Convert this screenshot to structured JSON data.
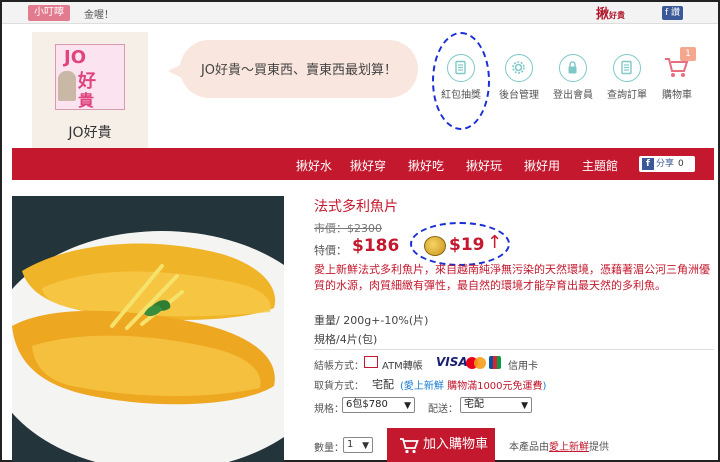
{
  "topbar": {
    "reminder_tag": "小叮嚀",
    "reminder_text": "金喔！",
    "share_logo": "揪",
    "share_logo_sub": "好貴",
    "fb_button": "f 讚"
  },
  "header": {
    "logo_chars": {
      "jo": "JO",
      "hao": "好",
      "gui": "貴"
    },
    "logo_name": "JO好貴",
    "slogan": "JO好貴～買東西、賣東西最划算！",
    "icons": [
      {
        "label": "紅包抽獎",
        "icon": "document-icon"
      },
      {
        "label": "後台管理",
        "icon": "gear-icon"
      },
      {
        "label": "登出會員",
        "icon": "lock-icon"
      },
      {
        "label": "查詢訂單",
        "icon": "document-icon"
      },
      {
        "label": "購物車",
        "icon": "cart-icon"
      }
    ],
    "cart_count": "1"
  },
  "nav": {
    "items": [
      "揪好水",
      "揪好穿",
      "揪好吃",
      "揪好玩",
      "揪好用",
      "主題館"
    ],
    "fb_share_label": "分享",
    "fb_share_count": "0"
  },
  "product": {
    "title": "法式多利魚片",
    "original_price": "市價：$2300",
    "sale_label": "特價：",
    "sale_price": "$186",
    "coin_price": "$19",
    "arrow": "↑",
    "description": "愛上新鮮法式多利魚片，來自越南純淨無污染的天然環境，憑藉著湄公河三角洲優質的水源，肉質細緻有彈性，最自然的環境才能孕育出最天然的多利魚。",
    "weight": "重量/ 200g+-10%(片)",
    "spec": "規格/4片(包)",
    "payment_label": "結帳方式：",
    "payment_atm": "ATM轉帳",
    "payment_visa": "VISA",
    "payment_card": "信用卡",
    "shipping_label": "取貨方式：",
    "shipping_method": "宅配",
    "shipping_note_open": "(",
    "shipping_note_brand": "愛上新鮮",
    "shipping_note_rest": " 購物滿1000元免運費",
    "shipping_note_close": ")",
    "spec_select_label": "規格：",
    "spec_select_value": "6包$780",
    "delivery_select_label": "配送：",
    "delivery_select_value": "宅配",
    "qty_label": "數量：",
    "qty_value": "1",
    "add_to_cart": "加入購物車",
    "provider_prefix": "本產品由",
    "provider_name": "愛上新鮮",
    "provider_suffix": "提供"
  },
  "colors": {
    "brand_red": "#c3182d",
    "accent_teal": "#7ec9c8",
    "annotation_blue": "#1a2fd6"
  }
}
